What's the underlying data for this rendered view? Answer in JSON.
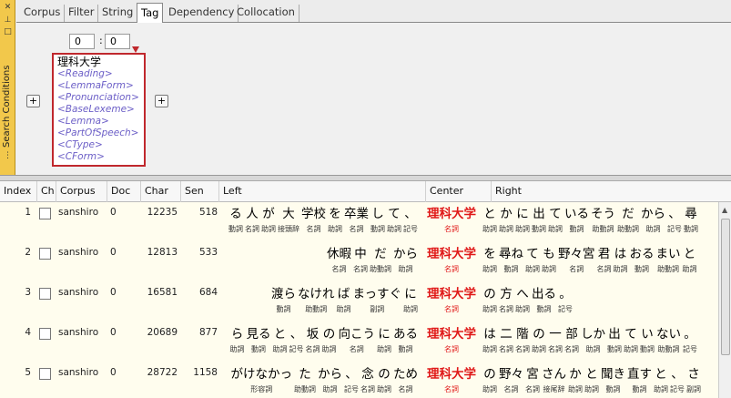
{
  "side": {
    "label": "Search Conditions",
    "icons": [
      "close-icon",
      "pin-icon",
      "restore-icon",
      "grip-icon"
    ]
  },
  "tabs": [
    "Corpus",
    "Filter",
    "String",
    "Tag",
    "Dependency",
    "Collocation"
  ],
  "active_tab": "Tag",
  "panel": {
    "range_from": "0",
    "range_to": "0",
    "range_sep": ":",
    "tag_title": "理科大学",
    "attributes": [
      "<Reading>",
      "<LemmaForm>",
      "<Pronunciation>",
      "<BaseLexeme>",
      "<Lemma>",
      "<PartOfSpeech>",
      "<CType>",
      "<CForm>"
    ],
    "add_left": "+",
    "add_right": "+"
  },
  "columns": [
    "Index",
    "Ch",
    "Corpus",
    "Doc",
    "Char",
    "Sen",
    "Left",
    "Center",
    "Right"
  ],
  "rows": [
    {
      "index": "1",
      "corpus": "sanshiro",
      "doc": "0",
      "char": "12235",
      "sen": "518",
      "left": [
        [
          "る",
          "動詞"
        ],
        [
          "人",
          "名詞"
        ],
        [
          "が",
          "助詞"
        ],
        [
          "大",
          "接頭辞"
        ],
        [
          "学校",
          "名詞"
        ],
        [
          "を",
          "助詞"
        ],
        [
          "卒業",
          "名詞"
        ],
        [
          "し",
          "動詞"
        ],
        [
          "て",
          "助詞"
        ],
        [
          "、",
          "記号"
        ]
      ],
      "center": [
        "理科大学",
        "名詞"
      ],
      "right": [
        [
          "と",
          "助詞"
        ],
        [
          "か",
          "助詞"
        ],
        [
          "に",
          "助詞"
        ],
        [
          "出",
          "動詞"
        ],
        [
          "て",
          "助詞"
        ],
        [
          "いる",
          "動詞"
        ],
        [
          "そう",
          "助動詞"
        ],
        [
          "だ",
          "助動詞"
        ],
        [
          "から",
          "助詞"
        ],
        [
          "、",
          "記号"
        ],
        [
          "尋",
          "動詞"
        ]
      ]
    },
    {
      "index": "2",
      "corpus": "sanshiro",
      "doc": "0",
      "char": "12813",
      "sen": "533",
      "left": [
        [
          "休暇",
          "名詞"
        ],
        [
          "中",
          "名詞"
        ],
        [
          "だ",
          "助動詞"
        ],
        [
          "から",
          "助詞"
        ]
      ],
      "center": [
        "理科大学",
        "名詞"
      ],
      "right": [
        [
          "を",
          "助詞"
        ],
        [
          "尋ね",
          "動詞"
        ],
        [
          "て",
          "助詞"
        ],
        [
          "も",
          "助詞"
        ],
        [
          "野々宮",
          "名詞"
        ],
        [
          "君",
          "名詞"
        ],
        [
          "は",
          "助詞"
        ],
        [
          "おる",
          "動詞"
        ],
        [
          "まい",
          "助動詞"
        ],
        [
          "と",
          "助詞"
        ]
      ]
    },
    {
      "index": "3",
      "corpus": "sanshiro",
      "doc": "0",
      "char": "16581",
      "sen": "684",
      "left": [
        [
          "渡ら",
          "動詞"
        ],
        [
          "なけれ",
          "助動詞"
        ],
        [
          "ば",
          "助詞"
        ],
        [
          "まっすぐ",
          "副詞"
        ],
        [
          "に",
          "助詞"
        ]
      ],
      "center": [
        "理科大学",
        "名詞"
      ],
      "right": [
        [
          "の",
          "助詞"
        ],
        [
          "方",
          "名詞"
        ],
        [
          "へ",
          "助詞"
        ],
        [
          "出る",
          "動詞"
        ],
        [
          "。",
          "記号"
        ]
      ]
    },
    {
      "index": "4",
      "corpus": "sanshiro",
      "doc": "0",
      "char": "20689",
      "sen": "877",
      "left": [
        [
          "ら",
          "助詞"
        ],
        [
          "見る",
          "動詞"
        ],
        [
          "と",
          "助詞"
        ],
        [
          "、",
          "記号"
        ],
        [
          "坂",
          "名詞"
        ],
        [
          "の",
          "助詞"
        ],
        [
          "向こう",
          "名詞"
        ],
        [
          "に",
          "助詞"
        ],
        [
          "ある",
          "動詞"
        ]
      ],
      "center": [
        "理科大学",
        "名詞"
      ],
      "right": [
        [
          "は",
          "助詞"
        ],
        [
          "二",
          "名詞"
        ],
        [
          "階",
          "名詞"
        ],
        [
          "の",
          "助詞"
        ],
        [
          "一",
          "名詞"
        ],
        [
          "部",
          "名詞"
        ],
        [
          "しか",
          "助詞"
        ],
        [
          "出",
          "動詞"
        ],
        [
          "て",
          "助詞"
        ],
        [
          "い",
          "動詞"
        ],
        [
          "ない",
          "助動詞"
        ],
        [
          "。",
          "記号"
        ]
      ]
    },
    {
      "index": "5",
      "corpus": "sanshiro",
      "doc": "0",
      "char": "28722",
      "sen": "1158",
      "left": [
        [
          "がけなかっ",
          "形容詞"
        ],
        [
          "た",
          "助動詞"
        ],
        [
          "から",
          "助詞"
        ],
        [
          "、",
          "記号"
        ],
        [
          "念",
          "名詞"
        ],
        [
          "の",
          "助詞"
        ],
        [
          "ため",
          "名詞"
        ]
      ],
      "center": [
        "理科大学",
        "名詞"
      ],
      "right": [
        [
          "の",
          "助詞"
        ],
        [
          "野々",
          "名詞"
        ],
        [
          "宮",
          "名詞"
        ],
        [
          "さん",
          "接尾辞"
        ],
        [
          "か",
          "助詞"
        ],
        [
          "と",
          "助詞"
        ],
        [
          "聞き",
          "動詞"
        ],
        [
          "直す",
          "動詞"
        ],
        [
          "と",
          "助詞"
        ],
        [
          "、",
          "記号"
        ],
        [
          "さ",
          "副詞"
        ]
      ]
    }
  ]
}
